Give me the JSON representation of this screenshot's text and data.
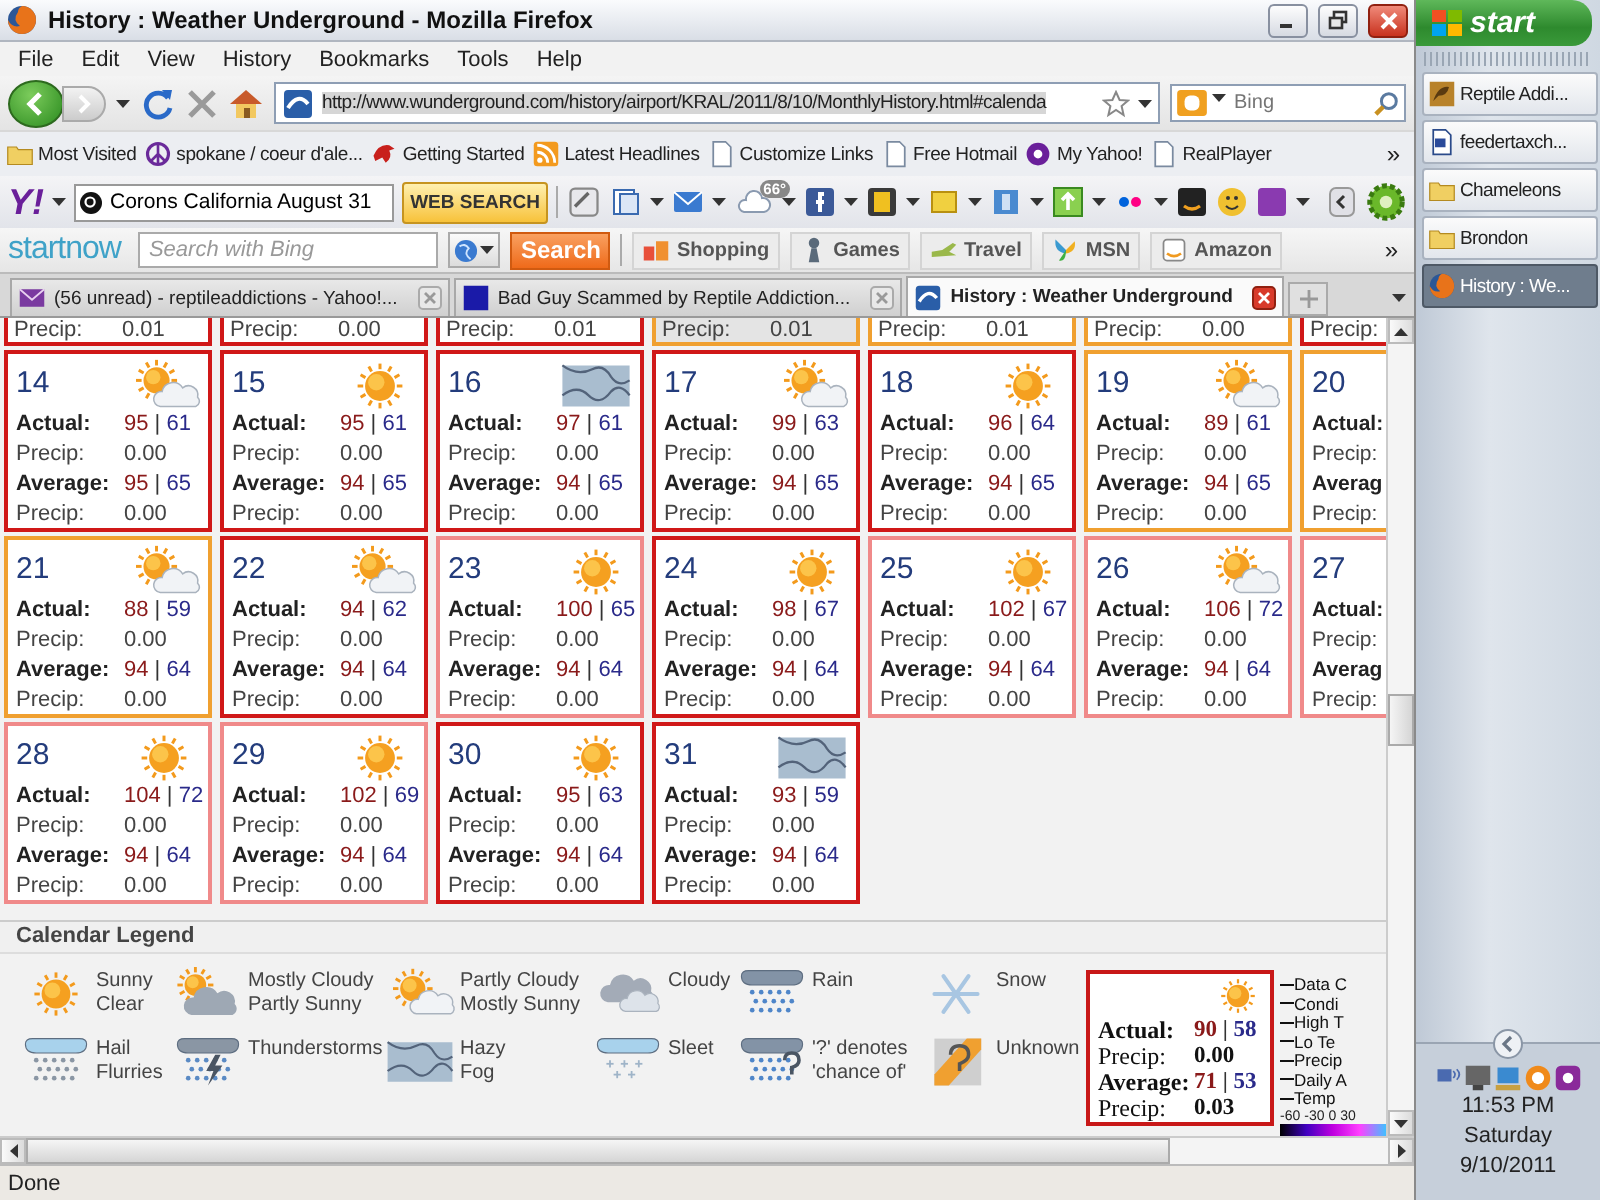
{
  "window": {
    "title": "History : Weather Underground - Mozilla Firefox"
  },
  "menu": [
    "File",
    "Edit",
    "View",
    "History",
    "Bookmarks",
    "Tools",
    "Help"
  ],
  "nav": {
    "url": "http://www.wunderground.com/history/airport/KRAL/2011/8/10/MonthlyHistory.html#calenda",
    "search_placeholder": "Bing"
  },
  "bookmarks": [
    "Most Visited",
    "spokane / coeur d'ale...",
    "Getting Started",
    "Latest Headlines",
    "Customize Links",
    "Free Hotmail",
    "My Yahoo!",
    "RealPlayer"
  ],
  "bookmarks_overflow": "»",
  "yahoo_bar": {
    "logo": "Y!",
    "search_value": "Corons California August 31",
    "button": "WEB SEARCH",
    "weather_badge": "66°"
  },
  "startnow_bar": {
    "logo": "startnow",
    "search_placeholder": "Search with Bing",
    "search_button": "Search",
    "links": [
      "Shopping",
      "Games",
      "Travel",
      "MSN",
      "Amazon"
    ],
    "overflow": "»"
  },
  "tabs": [
    {
      "label": "(56 unread) - reptileaddictions - Yahoo!...",
      "selected": false
    },
    {
      "label": "Bad Guy Scammed by Reptile Addiction...",
      "selected": false
    },
    {
      "label": "History : Weather Underground",
      "selected": true
    }
  ],
  "calendar": {
    "partial_row": [
      {
        "color": "#d01818",
        "highlighted": false,
        "label": "Precip:",
        "value": "0.01"
      },
      {
        "color": "#d01818",
        "highlighted": false,
        "label": "Precip:",
        "value": "0.00"
      },
      {
        "color": "#d01818",
        "highlighted": false,
        "label": "Precip:",
        "value": "0.01"
      },
      {
        "color": "#f0a030",
        "highlighted": true,
        "label": "Precip:",
        "value": "0.01"
      },
      {
        "color": "#f0a030",
        "highlighted": false,
        "label": "Precip:",
        "value": "0.01"
      },
      {
        "color": "#f0a030",
        "highlighted": false,
        "label": "Precip:",
        "value": "0.00"
      },
      {
        "color": "#d01818",
        "highlighted": false,
        "label": "Precip:"
      }
    ],
    "weeks": [
      {
        "days": [
          {
            "day": "14",
            "kind": "partly_cloudy",
            "color": "#d01818",
            "rows": [
              {
                "kind": "temps",
                "label": "Actual:",
                "value": "95 | 61"
              },
              {
                "kind": "precip",
                "label": "Precip:",
                "value": "0.00"
              },
              {
                "kind": "temps",
                "label": "Average:",
                "value": "95 | 65"
              },
              {
                "kind": "precip",
                "label": "Precip:",
                "value": "0.00"
              }
            ]
          },
          {
            "day": "15",
            "kind": "sunny",
            "color": "#d01818",
            "rows": [
              {
                "kind": "temps",
                "label": "Actual:",
                "value": "95 | 61"
              },
              {
                "kind": "precip",
                "label": "Precip:",
                "value": "0.00"
              },
              {
                "kind": "temps",
                "label": "Average:",
                "value": "94 | 65"
              },
              {
                "kind": "precip",
                "label": "Precip:",
                "value": "0.00"
              }
            ]
          },
          {
            "day": "16",
            "kind": "hazy",
            "color": "#d01818",
            "rows": [
              {
                "kind": "temps",
                "label": "Actual:",
                "value": "97 | 61"
              },
              {
                "kind": "precip",
                "label": "Precip:",
                "value": "0.00"
              },
              {
                "kind": "temps",
                "label": "Average:",
                "value": "94 | 65"
              },
              {
                "kind": "precip",
                "label": "Precip:",
                "value": "0.00"
              }
            ]
          },
          {
            "day": "17",
            "kind": "partly_cloudy",
            "color": "#d01818",
            "rows": [
              {
                "kind": "temps",
                "label": "Actual:",
                "value": "99 | 63"
              },
              {
                "kind": "precip",
                "label": "Precip:",
                "value": "0.00"
              },
              {
                "kind": "temps",
                "label": "Average:",
                "value": "94 | 65"
              },
              {
                "kind": "precip",
                "label": "Precip:",
                "value": "0.00"
              }
            ]
          },
          {
            "day": "18",
            "kind": "sunny",
            "color": "#d01818",
            "rows": [
              {
                "kind": "temps",
                "label": "Actual:",
                "value": "96 | 64"
              },
              {
                "kind": "precip",
                "label": "Precip:",
                "value": "0.00"
              },
              {
                "kind": "temps",
                "label": "Average:",
                "value": "94 | 65"
              },
              {
                "kind": "precip",
                "label": "Precip:",
                "value": "0.00"
              }
            ]
          },
          {
            "day": "19",
            "kind": "partly_cloudy",
            "color": "#f0a030",
            "rows": [
              {
                "kind": "temps",
                "label": "Actual:",
                "value": "89 | 61"
              },
              {
                "kind": "precip",
                "label": "Precip:",
                "value": "0.00"
              },
              {
                "kind": "temps",
                "label": "Average:",
                "value": "94 | 65"
              },
              {
                "kind": "precip",
                "label": "Precip:",
                "value": "0.00"
              }
            ]
          },
          {
            "day": "20",
            "kind": "cut",
            "color": "#f0a030",
            "rows": [
              {
                "kind": "temps",
                "label": "Actual:"
              },
              {
                "kind": "precip",
                "label": "Precip:"
              },
              {
                "kind": "temps",
                "label": "Averag"
              },
              {
                "kind": "precip",
                "label": "Precip:"
              }
            ]
          }
        ]
      },
      {
        "days": [
          {
            "day": "21",
            "kind": "partly_cloudy",
            "color": "#f0a030",
            "rows": [
              {
                "kind": "temps",
                "label": "Actual:",
                "value": "88 | 59"
              },
              {
                "kind": "precip",
                "label": "Precip:",
                "value": "0.00"
              },
              {
                "kind": "temps",
                "label": "Average:",
                "value": "94 | 64"
              },
              {
                "kind": "precip",
                "label": "Precip:",
                "value": "0.00"
              }
            ]
          },
          {
            "day": "22",
            "kind": "partly_cloudy",
            "color": "#d01818",
            "rows": [
              {
                "kind": "temps",
                "label": "Actual:",
                "value": "94 | 62"
              },
              {
                "kind": "precip",
                "label": "Precip:",
                "value": "0.00"
              },
              {
                "kind": "temps",
                "label": "Average:",
                "value": "94 | 64"
              },
              {
                "kind": "precip",
                "label": "Precip:",
                "value": "0.00"
              }
            ]
          },
          {
            "day": "23",
            "kind": "sunny",
            "color": "#f08a8a",
            "rows": [
              {
                "kind": "temps",
                "label": "Actual:",
                "value": "100 | 65"
              },
              {
                "kind": "precip",
                "label": "Precip:",
                "value": "0.00"
              },
              {
                "kind": "temps",
                "label": "Average:",
                "value": "94 | 64"
              },
              {
                "kind": "precip",
                "label": "Precip:",
                "value": "0.00"
              }
            ]
          },
          {
            "day": "24",
            "kind": "sunny",
            "color": "#d01818",
            "rows": [
              {
                "kind": "temps",
                "label": "Actual:",
                "value": "98 | 67"
              },
              {
                "kind": "precip",
                "label": "Precip:",
                "value": "0.00"
              },
              {
                "kind": "temps",
                "label": "Average:",
                "value": "94 | 64"
              },
              {
                "kind": "precip",
                "label": "Precip:",
                "value": "0.00"
              }
            ]
          },
          {
            "day": "25",
            "kind": "sunny",
            "color": "#f08a8a",
            "rows": [
              {
                "kind": "temps",
                "label": "Actual:",
                "value": "102 | 67"
              },
              {
                "kind": "precip",
                "label": "Precip:",
                "value": "0.00"
              },
              {
                "kind": "temps",
                "label": "Average:",
                "value": "94 | 64"
              },
              {
                "kind": "precip",
                "label": "Precip:",
                "value": "0.00"
              }
            ]
          },
          {
            "day": "26",
            "kind": "partly_cloudy",
            "color": "#f08a8a",
            "rows": [
              {
                "kind": "temps",
                "label": "Actual:",
                "value": "106 | 72"
              },
              {
                "kind": "precip",
                "label": "Precip:",
                "value": "0.00"
              },
              {
                "kind": "temps",
                "label": "Average:",
                "value": "94 | 64"
              },
              {
                "kind": "precip",
                "label": "Precip:",
                "value": "0.00"
              }
            ]
          },
          {
            "day": "27",
            "kind": "cut",
            "color": "#f08a8a",
            "rows": [
              {
                "kind": "temps",
                "label": "Actual:"
              },
              {
                "kind": "precip",
                "label": "Precip:"
              },
              {
                "kind": "temps",
                "label": "Averag"
              },
              {
                "kind": "precip",
                "label": "Precip:"
              }
            ]
          }
        ]
      },
      {
        "days": [
          {
            "day": "28",
            "kind": "sunny",
            "color": "#f08a8a",
            "rows": [
              {
                "kind": "temps",
                "label": "Actual:",
                "value": "104 | 72"
              },
              {
                "kind": "precip",
                "label": "Precip:",
                "value": "0.00"
              },
              {
                "kind": "temps",
                "label": "Average:",
                "value": "94 | 64"
              },
              {
                "kind": "precip",
                "label": "Precip:",
                "value": "0.00"
              }
            ]
          },
          {
            "day": "29",
            "kind": "sunny",
            "color": "#f08a8a",
            "rows": [
              {
                "kind": "temps",
                "label": "Actual:",
                "value": "102 | 69"
              },
              {
                "kind": "precip",
                "label": "Precip:",
                "value": "0.00"
              },
              {
                "kind": "temps",
                "label": "Average:",
                "value": "94 | 64"
              },
              {
                "kind": "precip",
                "label": "Precip:",
                "value": "0.00"
              }
            ]
          },
          {
            "day": "30",
            "kind": "sunny",
            "color": "#d01818",
            "rows": [
              {
                "kind": "temps",
                "label": "Actual:",
                "value": "95 | 63"
              },
              {
                "kind": "precip",
                "label": "Precip:",
                "value": "0.00"
              },
              {
                "kind": "temps",
                "label": "Average:",
                "value": "94 | 64"
              },
              {
                "kind": "precip",
                "label": "Precip:",
                "value": "0.00"
              }
            ]
          },
          {
            "day": "31",
            "kind": "hazy",
            "color": "#d01818",
            "rows": [
              {
                "kind": "temps",
                "label": "Actual:",
                "value": "93 | 59"
              },
              {
                "kind": "precip",
                "label": "Precip:",
                "value": "0.00"
              },
              {
                "kind": "temps",
                "label": "Average:",
                "value": "94 | 64"
              },
              {
                "kind": "precip",
                "label": "Precip:",
                "value": "0.00"
              }
            ]
          }
        ]
      }
    ]
  },
  "legend": {
    "title": "Calendar Legend",
    "items": [
      {
        "kind": "sunny",
        "lines": [
          "Sunny",
          "Clear"
        ]
      },
      {
        "kind": "mostly_cloudy",
        "lines": [
          "Mostly Cloudy",
          "Partly Sunny"
        ]
      },
      {
        "kind": "partly_cloudy",
        "lines": [
          "Partly Cloudy",
          "Mostly Sunny"
        ]
      },
      {
        "kind": "cloudy",
        "lines": [
          "Cloudy"
        ]
      },
      {
        "kind": "rain",
        "lines": [
          "Rain"
        ]
      },
      {
        "kind": "snow",
        "lines": [
          "Snow"
        ]
      },
      {
        "kind": "hail",
        "lines": [
          "Hail",
          "Flurries"
        ]
      },
      {
        "kind": "thunderstorms",
        "lines": [
          "Thunderstorms"
        ]
      },
      {
        "kind": "hazy",
        "lines": [
          "Hazy",
          "Fog"
        ]
      },
      {
        "kind": "sleet",
        "lines": [
          "Sleet"
        ]
      },
      {
        "kind": "chance",
        "lines": [
          "'?' denotes",
          "'chance of'"
        ]
      },
      {
        "kind": "unknown",
        "lines": [
          "Unknown"
        ]
      }
    ],
    "sample": {
      "kind": "sunny",
      "rows": [
        {
          "kind": "temps",
          "label": "Actual:",
          "value": "90 | 58"
        },
        {
          "kind": "precip",
          "label": "Precip:",
          "value": "0.00"
        },
        {
          "kind": "temps",
          "label": "Average:",
          "value": "71 | 53"
        },
        {
          "kind": "precip",
          "label": "Precip:",
          "value": "0.03"
        }
      ]
    },
    "callouts": [
      "Data C",
      "Condi",
      "High T",
      "Lo Te",
      "Precip",
      "Daily A",
      "Temp"
    ],
    "scale_ticks": [
      "-60",
      "-30",
      "0",
      "30"
    ]
  },
  "status_bar": "Done",
  "taskbar": {
    "start": "start",
    "items": [
      {
        "label": "Reptile Addi...",
        "selected": false
      },
      {
        "label": "feedertaxch...",
        "selected": false
      },
      {
        "label": "Chameleons",
        "selected": false
      },
      {
        "label": "Brondon",
        "selected": false
      },
      {
        "label": "History : We...",
        "selected": true
      }
    ],
    "clock": [
      "11:53 PM",
      "Saturday",
      "9/10/2011"
    ]
  }
}
